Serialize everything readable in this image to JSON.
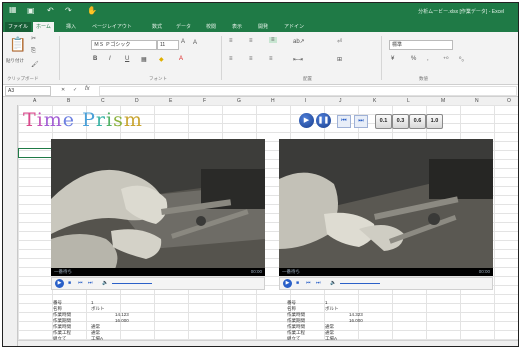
{
  "window": {
    "title": "分析ムービー.xlsx [作業データ] - Excel",
    "qa_icons": [
      "excel-icon",
      "save-icon",
      "undo-icon",
      "redo-icon",
      "touch-mode-icon"
    ]
  },
  "tabs": [
    {
      "label": "ファイル"
    },
    {
      "label": "ホーム"
    },
    {
      "label": "挿入"
    },
    {
      "label": "ページレイアウト"
    },
    {
      "label": "数式"
    },
    {
      "label": "データ"
    },
    {
      "label": "校閲"
    },
    {
      "label": "表示"
    },
    {
      "label": "開発"
    },
    {
      "label": "アドイン"
    }
  ],
  "ribbon": {
    "clipboard": {
      "paste_label": "貼り付け",
      "group_label": "クリップボード"
    },
    "font": {
      "name": "ＭＳ Ｐゴシック",
      "size": "11",
      "group_label": "フォント"
    },
    "alignment": {
      "group_label": "配置"
    },
    "number": {
      "format": "標準",
      "group_label": "数値"
    }
  },
  "formula_bar": {
    "name_box": "A3",
    "fx": "fx"
  },
  "columns": [
    "A",
    "B",
    "C",
    "D",
    "E",
    "F",
    "G",
    "H",
    "I",
    "J",
    "K",
    "L",
    "M",
    "N",
    "O"
  ],
  "logo": {
    "text": "Time Prism",
    "letter_colors": [
      "#d94a8c",
      "#c653b8",
      "#a35fd4",
      "#6c7fe0",
      "#4aa0d8",
      "#3bb3a6",
      "#52b266",
      "#8bb23c",
      "#c9a532",
      "#e07b2e"
    ]
  },
  "controls": {
    "play_icon": "play-icon",
    "pause_icon": "pause-icon",
    "back_icon": "skip-back-icon",
    "forward_icon": "skip-forward-icon",
    "speeds": [
      "0.1",
      "0.3",
      "0.6",
      "1.0"
    ]
  },
  "videos": [
    {
      "caption": "一番待ち",
      "time": "00:00",
      "info": [
        {
          "k": "番号",
          "v": "1",
          "v2": ""
        },
        {
          "k": "名称",
          "v": "ボルト",
          "v2": ""
        },
        {
          "k": "作業時間",
          "v": "14.123",
          "v2": ""
        },
        {
          "k": "作業期間",
          "v": "16.000",
          "v2": ""
        },
        {
          "k": "作業時間",
          "v": "通常",
          "v2": ""
        },
        {
          "k": "作業工程",
          "v": "通常",
          "v2": ""
        },
        {
          "k": "組立て",
          "v": "工場A",
          "v2": ""
        }
      ]
    },
    {
      "caption": "一番待ち",
      "time": "00:00",
      "info": [
        {
          "k": "番号",
          "v": "1",
          "v2": ""
        },
        {
          "k": "名称",
          "v": "ボルト",
          "v2": ""
        },
        {
          "k": "作業時間",
          "v": "14.323",
          "v2": ""
        },
        {
          "k": "作業期間",
          "v": "16.000",
          "v2": ""
        },
        {
          "k": "作業時間",
          "v": "通常",
          "v2": ""
        },
        {
          "k": "作業工程",
          "v": "通常",
          "v2": ""
        },
        {
          "k": "組立て",
          "v": "工場A",
          "v2": ""
        }
      ]
    }
  ],
  "colors": {
    "excel_green": "#1f7a46",
    "control_blue": "#1f4fa8"
  }
}
